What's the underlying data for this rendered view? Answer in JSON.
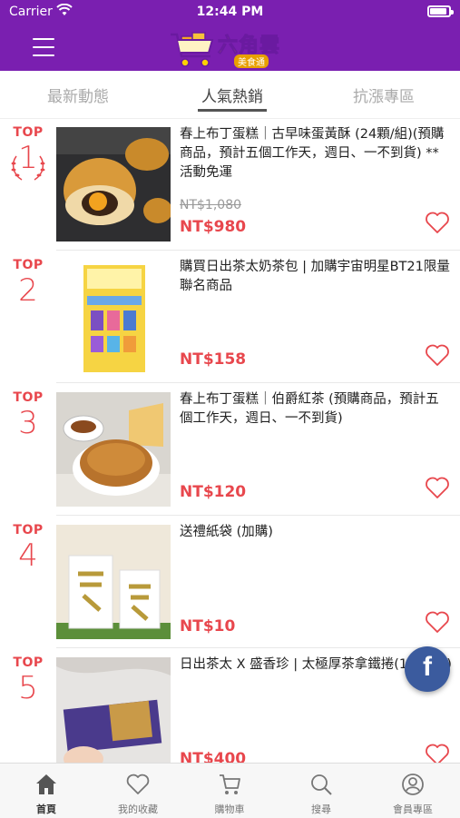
{
  "status_bar": {
    "carrier": "Carrier",
    "time": "12:44 PM"
  },
  "header": {
    "brand": "六角雲",
    "brand_sub": "美食通"
  },
  "tabs": [
    {
      "label": "最新動態"
    },
    {
      "label": "人氣熱銷",
      "active": true
    },
    {
      "label": "抗漲專區"
    }
  ],
  "products": [
    {
      "rank_prefix": "TOP",
      "rank": "1",
      "title": "春上布丁蛋糕｜古早味蛋黃酥 (24顆/組)(預購商品，預計五個工作天，週日、一不到貨) **活動免運",
      "old_price": "NT$1,080",
      "price": "NT$980"
    },
    {
      "rank_prefix": "TOP",
      "rank": "2",
      "title": "購買日出茶太奶茶包 | 加購宇宙明星BT21限量聯名商品",
      "price": "NT$158"
    },
    {
      "rank_prefix": "TOP",
      "rank": "3",
      "title": "春上布丁蛋糕｜伯爵紅茶 (預購商品，預計五個工作天，週日、一不到貨)",
      "price": "NT$120"
    },
    {
      "rank_prefix": "TOP",
      "rank": "4",
      "title": "送禮紙袋 (加購)",
      "price": "NT$10"
    },
    {
      "rank_prefix": "TOP",
      "rank": "5",
      "title": "日出茶太 X 盛香珍 | 太極厚茶拿鐵捲(10盒/箱)",
      "price": "NT$400"
    }
  ],
  "bottom_nav": [
    {
      "label": "首頁",
      "icon": "home-icon",
      "active": true
    },
    {
      "label": "我的收藏",
      "icon": "heart-icon"
    },
    {
      "label": "購物車",
      "icon": "cart-icon"
    },
    {
      "label": "搜尋",
      "icon": "search-icon"
    },
    {
      "label": "會員專區",
      "icon": "user-icon"
    }
  ],
  "colors": {
    "brand": "#7a1fb0",
    "accent": "#e8474d",
    "facebook": "#3b5b9e"
  }
}
